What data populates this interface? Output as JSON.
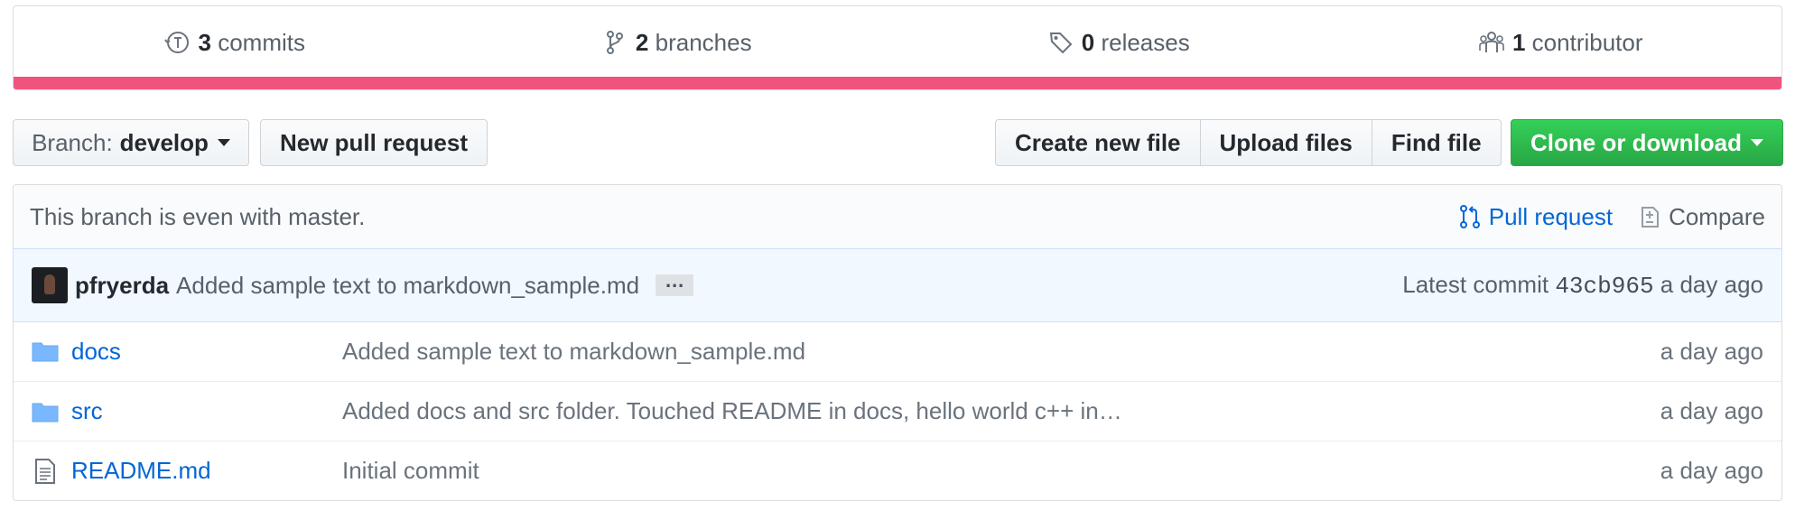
{
  "summary": {
    "commits": {
      "count": "3",
      "label": "commits"
    },
    "branches": {
      "count": "2",
      "label": "branches"
    },
    "releases": {
      "count": "0",
      "label": "releases"
    },
    "contributors": {
      "count": "1",
      "label": "contributor"
    },
    "language_color": "#f1537f"
  },
  "toolbar": {
    "branch_prefix": "Branch:",
    "branch_name": "develop",
    "new_pr_label": "New pull request",
    "create_file_label": "Create new file",
    "upload_label": "Upload files",
    "find_label": "Find file",
    "clone_label": "Clone or download"
  },
  "branch_info": {
    "status": "This branch is even with master.",
    "pull_request_label": "Pull request",
    "compare_label": "Compare"
  },
  "latest_commit": {
    "author": "pfryerda",
    "message": "Added sample text to markdown_sample.md",
    "ellipsis": "…",
    "prefix": "Latest commit",
    "sha": "43cb965",
    "age": "a day ago"
  },
  "files": [
    {
      "type": "folder",
      "name": "docs",
      "message": "Added sample text to markdown_sample.md",
      "age": "a day ago"
    },
    {
      "type": "folder",
      "name": "src",
      "message": "Added docs and src folder. Touched README in docs, hello world c++ in…",
      "age": "a day ago"
    },
    {
      "type": "file",
      "name": "README.md",
      "message": "Initial commit",
      "age": "a day ago"
    }
  ],
  "colors": {
    "link": "#0366d6",
    "clone_green": "#28a745",
    "lang_bar": "#f1537f"
  }
}
